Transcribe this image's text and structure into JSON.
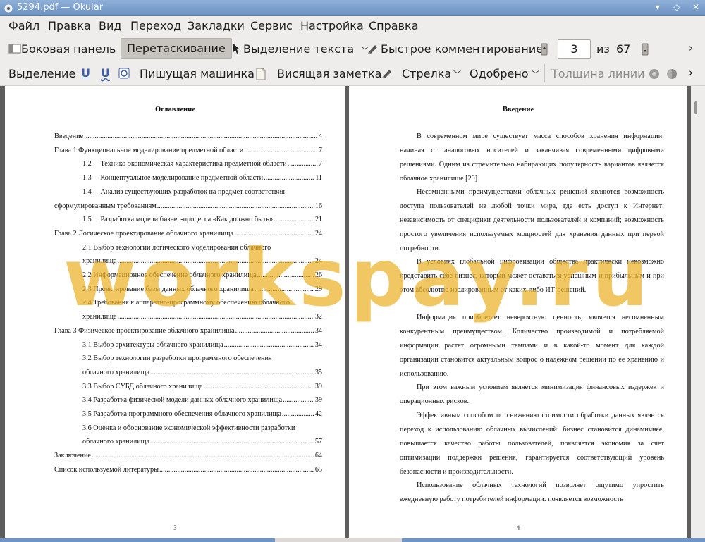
{
  "window": {
    "title": "5294.pdf — Okular"
  },
  "menu": [
    "Файл",
    "Правка",
    "Вид",
    "Переход",
    "Закладки",
    "Сервис",
    "Настройка",
    "Справка"
  ],
  "toolbar": {
    "sidebar": "Боковая панель",
    "browse": "Перетаскивание",
    "text_select": "Выделение текста",
    "quick_annot": "Быстрое комментирование",
    "page_current": "3",
    "page_of": "из",
    "page_total": "67"
  },
  "annot_toolbar": {
    "highlight": "Выделение",
    "typewriter": "Пишущая машинка",
    "note": "Висящая заметка",
    "arrow": "Стрелка",
    "stamp": "Одобрено",
    "line_width": "Толщина линии"
  },
  "page_left": {
    "title": "Оглавление",
    "toc": [
      {
        "t": "Введение",
        "n": "4"
      },
      {
        "t": "Глава 1 Функциональное моделирование предметной области",
        "n": "7"
      },
      {
        "t": "1.2     Технико-экономическая характеристика предметной области",
        "n": "7"
      },
      {
        "t": "1.3     Концептуальное моделирование предметной области",
        "n": "11"
      },
      {
        "t": "1.4     Анализ существующих разработок на предмет соответствия"
      },
      {
        "t": "сформулированным требованиям",
        "n": "16"
      },
      {
        "t": "1.5     Разработка модели бизнес-процесса «Как должно быть»",
        "n": "21"
      },
      {
        "t": "Глава 2 Логическое проектирование облачного хранилища",
        "n": "24"
      },
      {
        "t": "2.1 Выбор технологии логического моделирования облачного"
      },
      {
        "t": "хранилища",
        "n": "24"
      },
      {
        "t": "2.2 Информационное обеспечение облачного хранилища",
        "n": "26"
      },
      {
        "t": "2.3 Проектирование базы данных облачного хранилища",
        "n": "29"
      },
      {
        "t": "2.4 Требования к аппаратно-программному обеспечению облачного"
      },
      {
        "t": "хранилища",
        "n": "32"
      },
      {
        "t": "Глава 3 Физическое проектирование облачного хранилища",
        "n": "34"
      },
      {
        "t": "3.1 Выбор архитектуры облачного хранилища",
        "n": "34"
      },
      {
        "t": "3.2 Выбор технологии разработки программного обеспечения"
      },
      {
        "t": "облачного хранилища",
        "n": "35"
      },
      {
        "t": "3.3 Выбор СУБД облачного хранилища",
        "n": "39"
      },
      {
        "t": "3.4 Разработка физической модели данных облачного хранилища",
        "n": "39"
      },
      {
        "t": "3.5 Разработка программного обеспечения облачного хранилища",
        "n": "42"
      },
      {
        "t": "3.6 Оценка и обоснование экономической эффективности разработки"
      },
      {
        "t": "облачного хранилища",
        "n": "57"
      },
      {
        "t": "Заключение",
        "n": "64"
      },
      {
        "t": "Список используемой литературы",
        "n": "65"
      }
    ],
    "page_number": "3"
  },
  "page_right": {
    "title": "Введение",
    "paragraphs": [
      "В современном мире существует масса способов хранения информации: начиная от аналоговых носителей и заканчивая современными цифровыми решениями. Одним из стремительно набирающих популярность вариантов является облачное хранилище [29].",
      "Несомненными преимуществами облачных решений являются возможность доступа пользователей из любой точки мира, где есть доступ к Интернет; независимость от специфики деятельности пользователей и компаний; возможность простого увеличения используемых мощностей для хранения данных при первой потребности.",
      "В условиях глобальной цифровизации общества практически невозможно представить себе бизнес, который может оставаться успешным и прибыльным и при этом абсолютно изолированным от каких-либо ИТ-решений.",
      "Информация приобретает невероятную ценность, является несомненным конкурентным преимуществом. Количество производимой и потребляемой информации растет огромными темпами и в какой-то момент для каждой организации становится актуальным вопрос о надежном решении по её хранению и использованию.",
      "При этом важным условием является минимизация финансовых издержек и операционных рисков.",
      "Эффективным способом по снижению стоимости обработки данных является переход к использованию облачных вычислений: бизнес становится динамичнее, повышается качество работы пользователей, появляется экономия за счет оптимизации поддержки решения, гарантируется соответствующий уровень безопасности и производительности.",
      "Использование облачных технологий позволяет ощутимо упростить ежедневную работу потребителей информации: появляется возможность"
    ],
    "page_number": "4"
  },
  "watermark": "workspay.ru"
}
